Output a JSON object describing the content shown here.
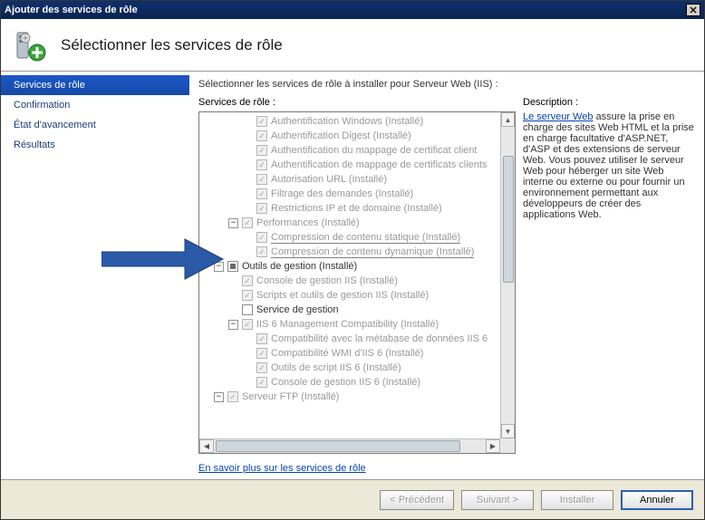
{
  "window": {
    "title": "Ajouter des services de rôle"
  },
  "header": {
    "title": "Sélectionner les services de rôle"
  },
  "sidebar": {
    "items": [
      {
        "label": "Services de rôle",
        "active": true
      },
      {
        "label": "Confirmation",
        "active": false
      },
      {
        "label": "État d'avancement",
        "active": false
      },
      {
        "label": "Résultats",
        "active": false
      }
    ]
  },
  "main": {
    "intro": "Sélectionner les services de rôle à installer pour Serveur Web (IIS) :",
    "tree_label": "Services de rôle :",
    "description_label": "Description :",
    "description_link": "Le serveur Web",
    "description_text": " assure la prise en charge des sites Web HTML et la prise en charge facultative d'ASP.NET, d'ASP et des extensions de serveur Web. Vous pouvez utiliser le serveur Web pour héberger un site Web interne ou externe ou pour fournir un environnement permettant aux développeurs de créer des applications Web.",
    "learn_more": "En savoir plus sur les services de rôle",
    "rows": [
      {
        "indent": 3,
        "expander": null,
        "checked": true,
        "disabled": true,
        "label": "Authentification Windows  (Installé)"
      },
      {
        "indent": 3,
        "expander": null,
        "checked": true,
        "disabled": true,
        "label": "Authentification Digest  (Installé)"
      },
      {
        "indent": 3,
        "expander": null,
        "checked": true,
        "disabled": true,
        "label": "Authentification du mappage de certificat client"
      },
      {
        "indent": 3,
        "expander": null,
        "checked": true,
        "disabled": true,
        "label": "Authentification de mappage de certificats clients"
      },
      {
        "indent": 3,
        "expander": null,
        "checked": true,
        "disabled": true,
        "label": "Autorisation URL  (Installé)"
      },
      {
        "indent": 3,
        "expander": null,
        "checked": true,
        "disabled": true,
        "label": "Filtrage des demandes  (Installé)"
      },
      {
        "indent": 3,
        "expander": null,
        "checked": true,
        "disabled": true,
        "label": "Restrictions IP et de domaine  (Installé)"
      },
      {
        "indent": 2,
        "expander": "-",
        "checked": true,
        "disabled": true,
        "label": "Performances  (Installé)"
      },
      {
        "indent": 3,
        "expander": null,
        "checked": true,
        "disabled": true,
        "label": "Compression de contenu statique  (Installé)",
        "underline": true
      },
      {
        "indent": 3,
        "expander": null,
        "checked": true,
        "disabled": true,
        "label": "Compression de contenu dynamique  (Installé)",
        "underline": true
      },
      {
        "indent": 1,
        "expander": "-",
        "checked": "half",
        "disabled": false,
        "label": "Outils de gestion  (Installé)"
      },
      {
        "indent": 2,
        "expander": null,
        "checked": true,
        "disabled": true,
        "label": "Console de gestion IIS  (Installé)"
      },
      {
        "indent": 2,
        "expander": null,
        "checked": true,
        "disabled": true,
        "label": "Scripts et outils de gestion IIS  (Installé)"
      },
      {
        "indent": 2,
        "expander": null,
        "checked": false,
        "disabled": false,
        "label": "Service de gestion"
      },
      {
        "indent": 2,
        "expander": "-",
        "checked": true,
        "disabled": true,
        "label": "IIS 6 Management Compatibility  (Installé)"
      },
      {
        "indent": 3,
        "expander": null,
        "checked": true,
        "disabled": true,
        "label": "Compatibilité avec la métabase de données IIS 6"
      },
      {
        "indent": 3,
        "expander": null,
        "checked": true,
        "disabled": true,
        "label": "Compatibilité WMI d'IIS 6  (Installé)"
      },
      {
        "indent": 3,
        "expander": null,
        "checked": true,
        "disabled": true,
        "label": "Outils de script IIS 6  (Installé)"
      },
      {
        "indent": 3,
        "expander": null,
        "checked": true,
        "disabled": true,
        "label": "Console de gestion IIS 6  (Installé)"
      },
      {
        "indent": 1,
        "expander": "-",
        "checked": true,
        "disabled": true,
        "label": "Serveur FTP  (Installé)"
      }
    ]
  },
  "footer": {
    "prev": "< Précédent",
    "next": "Suivant >",
    "install": "Installer",
    "cancel": "Annuler"
  }
}
